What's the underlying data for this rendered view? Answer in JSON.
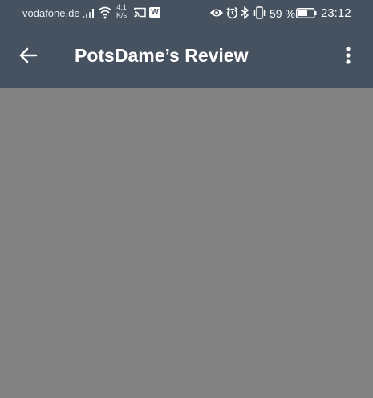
{
  "status_bar": {
    "carrier": "vodafone.de",
    "speed_value": "4,1",
    "speed_unit": "K/s",
    "w_badge": "W",
    "battery_percent": "59 %",
    "time": "23:12",
    "icons": [
      "signal-bars-icon",
      "wifi-icon",
      "cast-icon",
      "w-app-icon",
      "eye-icon",
      "alarm-icon",
      "bluetooth-icon",
      "vibrate-icon",
      "battery-icon"
    ]
  },
  "app_bar": {
    "title": "PotsDame’s Review",
    "back_icon": "arrow-left-icon",
    "menu_icon": "more-vertical-icon"
  },
  "colors": {
    "app_bar_bg": "#46525f",
    "content_bg": "#818181",
    "text": "#ffffff"
  }
}
